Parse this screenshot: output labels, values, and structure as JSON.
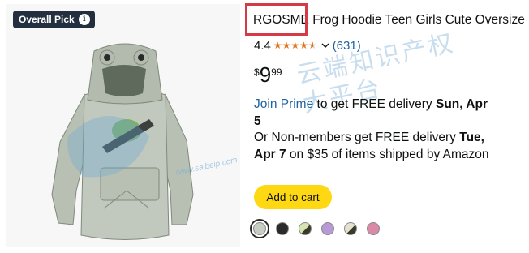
{
  "badge": {
    "label": "Overall Pick",
    "info_icon": "i"
  },
  "product": {
    "brand": "RGOSME",
    "title_rest": " Frog Hoodie Teen Girls Cute Oversize",
    "rating_value": "4.4",
    "stars": [
      1,
      1,
      1,
      1,
      0.5
    ],
    "rating_count": "(631)",
    "price": {
      "currency": "$",
      "whole": "9",
      "fraction": "99"
    }
  },
  "delivery": {
    "join_prime": "Join Prime",
    "line1": " to get FREE delivery ",
    "date1": "Sun, Apr 5",
    "line2": "Or Non-members get FREE delivery ",
    "date2": "Tue, Apr 7",
    "line3": " on $35 of items shipped by Amazon"
  },
  "actions": {
    "add_to_cart": "Add to cart"
  },
  "swatches": {
    "colors": [
      "#c7cdc3",
      "#2b2b2b",
      "#d6e3b4",
      "#b79ad6",
      "#e4e2cf",
      "#d98aa6"
    ],
    "selected_index": 0
  },
  "watermark": {
    "chinese": "云端知识产权大平台",
    "url": "www.saibeip.com"
  },
  "colors": {
    "accent_link": "#2162a1",
    "star": "#de7921",
    "cart_button": "#ffd814",
    "highlight_box": "#d53b47"
  }
}
